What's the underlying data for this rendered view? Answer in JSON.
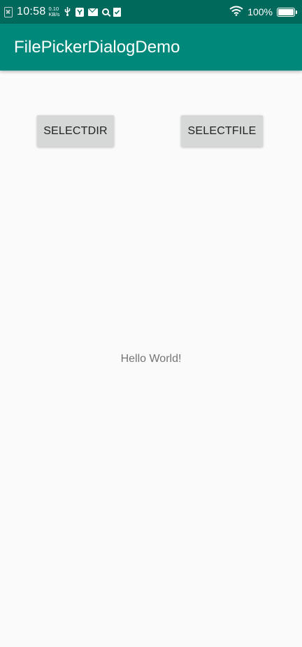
{
  "status_bar": {
    "time": "10:58",
    "net_speed_value": "0.10",
    "net_speed_unit": "KB/s",
    "battery_percent": "100%",
    "battery_level": 1.0,
    "icons": [
      "sim-absent-icon",
      "usb-icon",
      "notification-app-icon",
      "mail-icon",
      "search-icon",
      "clipboard-icon",
      "wifi-icon",
      "battery-icon"
    ]
  },
  "app_bar": {
    "title": "FilePickerDialogDemo",
    "background": "#00897b",
    "status_background": "#00695c"
  },
  "buttons": {
    "select_dir": "SELECTDIR",
    "select_file": "SELECTFILE"
  },
  "main": {
    "message": "Hello World!"
  }
}
